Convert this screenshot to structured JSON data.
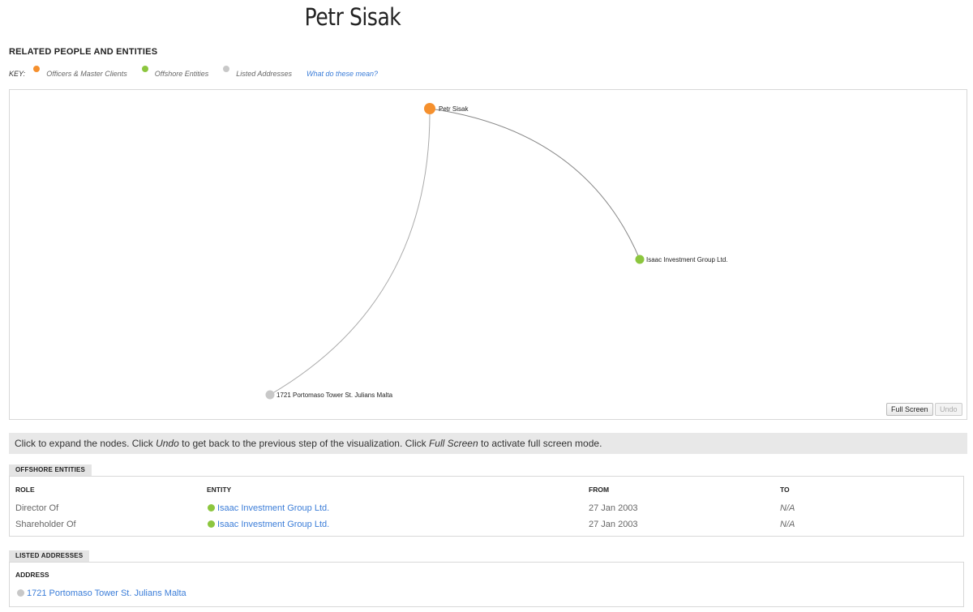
{
  "page": {
    "title": "Petr Sisak"
  },
  "related": {
    "heading": "RELATED PEOPLE AND ENTITIES",
    "key_label": "KEY:",
    "key_items": [
      {
        "label": "Officers & Master Clients",
        "color": "#f5902e"
      },
      {
        "label": "Offshore Entities",
        "color": "#8cc63e"
      },
      {
        "label": "Listed Addresses",
        "color": "#c8c8c8"
      }
    ],
    "key_link": "What do these mean?"
  },
  "graph": {
    "nodes": [
      {
        "label": "Petr Sisak",
        "type": "officer",
        "color": "#f5902e"
      },
      {
        "label": "Isaac Investment Group Ltd.",
        "type": "entity",
        "color": "#8cc63e"
      },
      {
        "label": "1721 Portomaso Tower St. Julians Malta",
        "type": "address",
        "color": "#c8c8c8"
      }
    ],
    "full_screen_label": "Full Screen",
    "undo_label": "Undo"
  },
  "instructions": {
    "part1": "Click to expand the nodes. Click ",
    "undo_word": "Undo",
    "part2": " to get back to the previous step of the visualization. Click ",
    "full_screen_word": "Full Screen",
    "part3": " to activate full screen mode."
  },
  "offshore": {
    "tab": "OFFSHORE ENTITIES",
    "columns": {
      "role": "ROLE",
      "entity": "ENTITY",
      "from": "FROM",
      "to": "TO"
    },
    "rows": [
      {
        "role": "Director Of",
        "entity": "Isaac Investment Group Ltd.",
        "from": "27 Jan 2003",
        "to": "N/A"
      },
      {
        "role": "Shareholder Of",
        "entity": "Isaac Investment Group Ltd.",
        "from": "27 Jan 2003",
        "to": "N/A"
      }
    ]
  },
  "addresses": {
    "tab": "LISTED ADDRESSES",
    "column": "ADDRESS",
    "rows": [
      {
        "address": "1721 Portomaso Tower St. Julians Malta"
      }
    ]
  }
}
